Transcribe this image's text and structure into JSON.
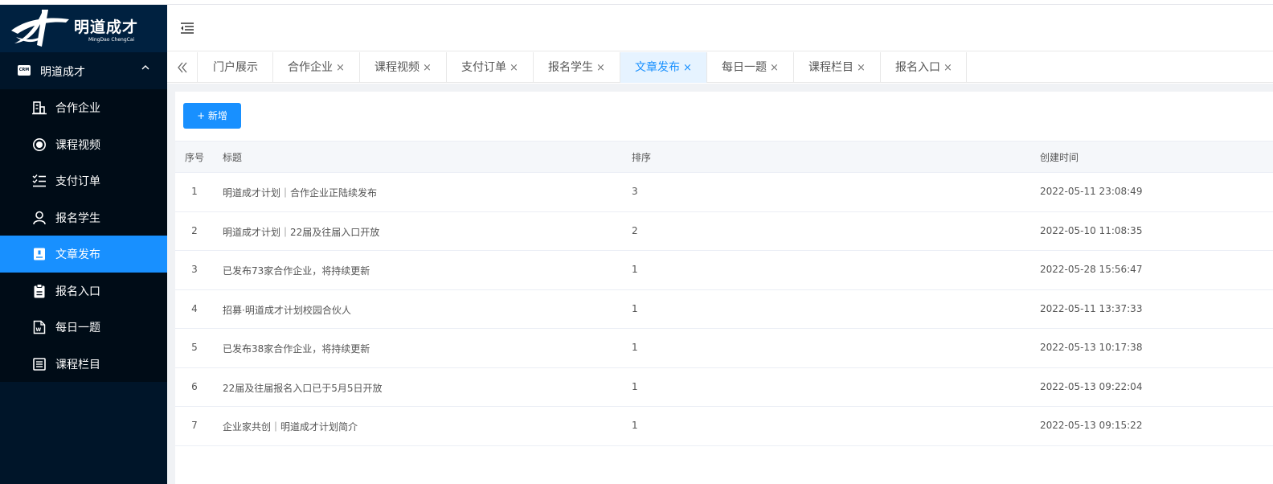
{
  "brand": {
    "title": "明道成才",
    "subtitle": "MingDao ChengCai",
    "badge": "CRM"
  },
  "sidebar": {
    "group_label": "明道成才",
    "items": [
      {
        "label": "合作企业",
        "icon": "building-icon"
      },
      {
        "label": "课程视频",
        "icon": "record-icon"
      },
      {
        "label": "支付订单",
        "icon": "checklist-icon"
      },
      {
        "label": "报名学生",
        "icon": "user-icon"
      },
      {
        "label": "文章发布",
        "icon": "article-icon",
        "active": true
      },
      {
        "label": "报名入口",
        "icon": "clipboard-icon"
      },
      {
        "label": "每日一题",
        "icon": "word-doc-icon"
      },
      {
        "label": "课程栏目",
        "icon": "list-icon"
      }
    ]
  },
  "tabs": [
    {
      "label": "门户展示"
    },
    {
      "label": "合作企业",
      "close": "×"
    },
    {
      "label": "课程视频",
      "close": "×"
    },
    {
      "label": "支付订单",
      "close": "×"
    },
    {
      "label": "报名学生",
      "close": "×"
    },
    {
      "label": "文章发布",
      "close": "×",
      "active": true
    },
    {
      "label": "每日一题",
      "close": "×"
    },
    {
      "label": "课程栏目",
      "close": "×"
    },
    {
      "label": "报名入口",
      "close": "×"
    }
  ],
  "toolbar": {
    "add_label": "+ 新增"
  },
  "table": {
    "columns": {
      "index": "序号",
      "title": "标题",
      "sort": "排序",
      "created": "创建时间"
    },
    "rows": [
      {
        "index": "1",
        "title": "明道成才计划｜合作企业正陆续发布",
        "sort": "3",
        "created": "2022-05-11 23:08:49"
      },
      {
        "index": "2",
        "title": "明道成才计划｜22届及往届入口开放",
        "sort": "2",
        "created": "2022-05-10 11:08:35"
      },
      {
        "index": "3",
        "title": "已发布73家合作企业，将持续更新",
        "sort": "1",
        "created": "2022-05-28 15:56:47"
      },
      {
        "index": "4",
        "title": "招募·明道成才计划校园合伙人",
        "sort": "1",
        "created": "2022-05-11 13:37:33"
      },
      {
        "index": "5",
        "title": "已发布38家合作企业，将持续更新",
        "sort": "1",
        "created": "2022-05-13 10:17:38"
      },
      {
        "index": "6",
        "title": "22届及往届报名入口已于5月5日开放",
        "sort": "1",
        "created": "2022-05-13 09:22:04"
      },
      {
        "index": "7",
        "title": "企业家共创｜明道成才计划简介",
        "sort": "1",
        "created": "2022-05-13 09:15:22"
      }
    ]
  },
  "colors": {
    "sidebar_bg": "#001529",
    "submenu_bg": "#000c17",
    "accent": "#1890ff",
    "active_tab_bg": "#e6f3ff"
  }
}
